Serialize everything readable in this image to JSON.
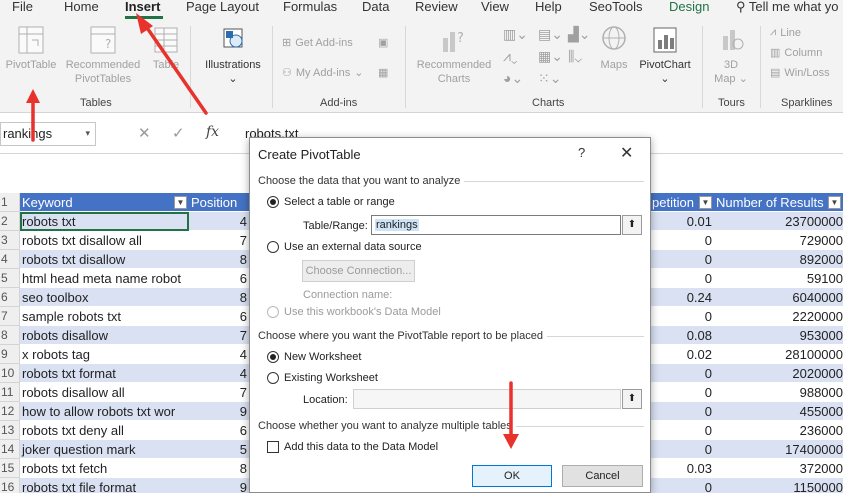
{
  "menu": {
    "items": [
      "File",
      "Home",
      "Insert",
      "Page Layout",
      "Formulas",
      "Data",
      "Review",
      "View",
      "Help",
      "SeoTools",
      "Design"
    ],
    "tell_me": "Tell me what yo"
  },
  "ribbon": {
    "pivot_table": "PivotTable",
    "recommended_pivot_line1": "Recommended",
    "recommended_pivot_line2": "PivotTables",
    "table": "Table",
    "group_tables": "Tables",
    "illustrations": "Illustrations",
    "get_addins": "Get Add-ins",
    "my_addins": "My Add-ins",
    "group_addins": "Add-ins",
    "recommended_charts_line1": "Recommended",
    "recommended_charts_line2": "Charts",
    "maps": "Maps",
    "pivot_chart": "PivotChart",
    "map3d_line1": "3D",
    "map3d_line2": "Map",
    "group_charts": "Charts",
    "group_tours": "Tours",
    "line": "Line",
    "column": "Column",
    "win_loss": "Win/Loss",
    "group_sparklines": "Sparklines"
  },
  "formula_bar": {
    "name_box": "rankings",
    "content": "robots.txt",
    "fx": "fx"
  },
  "sheet": {
    "headers": {
      "keyword": "Keyword",
      "position": "Position",
      "competition": "petition",
      "results": "Number of Results"
    },
    "rows": [
      {
        "n": "2",
        "keyword": "robots txt",
        "position": "4",
        "competition": "0.01",
        "results": "23700000"
      },
      {
        "n": "3",
        "keyword": "robots txt disallow all",
        "position": "7",
        "competition": "0",
        "results": "729000"
      },
      {
        "n": "4",
        "keyword": "robots txt disallow",
        "position": "8",
        "competition": "0",
        "results": "892000"
      },
      {
        "n": "5",
        "keyword": "html head meta name robot",
        "position": "6",
        "competition": "0",
        "results": "59100"
      },
      {
        "n": "6",
        "keyword": "seo toolbox",
        "position": "8",
        "competition": "0.24",
        "results": "6040000"
      },
      {
        "n": "7",
        "keyword": "sample robots txt",
        "position": "6",
        "competition": "0",
        "results": "2220000"
      },
      {
        "n": "8",
        "keyword": "robots disallow",
        "position": "7",
        "competition": "0.08",
        "results": "953000"
      },
      {
        "n": "9",
        "keyword": "x robots tag",
        "position": "4",
        "competition": "0.02",
        "results": "28100000"
      },
      {
        "n": "10",
        "keyword": "robots txt format",
        "position": "4",
        "competition": "0",
        "results": "2020000"
      },
      {
        "n": "11",
        "keyword": "robots disallow all",
        "position": "7",
        "competition": "0",
        "results": "988000"
      },
      {
        "n": "12",
        "keyword": "how to allow robots txt wor",
        "position": "9",
        "competition": "0",
        "results": "455000"
      },
      {
        "n": "13",
        "keyword": "robots txt deny all",
        "position": "6",
        "competition": "0",
        "results": "236000"
      },
      {
        "n": "14",
        "keyword": "joker question mark",
        "position": "5",
        "competition": "0",
        "results": "17400000"
      },
      {
        "n": "15",
        "keyword": "robots txt fetch",
        "position": "8",
        "competition": "0.03",
        "results": "372000"
      },
      {
        "n": "16",
        "keyword": "robots txt file format",
        "position": "9",
        "competition": "0",
        "results": "1150000"
      }
    ]
  },
  "dialog": {
    "title": "Create PivotTable",
    "help": "?",
    "close": "✕",
    "section_choose_data": "Choose the data that you want to analyze",
    "select_table": "Select a table or range",
    "table_range_label": "Table/Range:",
    "table_range_value": "rankings",
    "use_external": "Use an external data source",
    "choose_connection": "Choose Connection...",
    "connection_name": "Connection name:",
    "use_data_model": "Use this workbook's Data Model",
    "section_place": "Choose where you want the PivotTable report to be placed",
    "new_worksheet": "New Worksheet",
    "existing_worksheet": "Existing Worksheet",
    "location_label": "Location:",
    "location_value": "",
    "section_multiple": "Choose whether you want to analyze multiple tables",
    "add_data_model": "Add this data to the Data Model",
    "ok": "OK",
    "cancel": "Cancel"
  },
  "colors": {
    "accent": "#217346",
    "header_blue": "#4472c4",
    "band_blue": "#d9e1f2",
    "arrow_red": "#e8322c"
  }
}
